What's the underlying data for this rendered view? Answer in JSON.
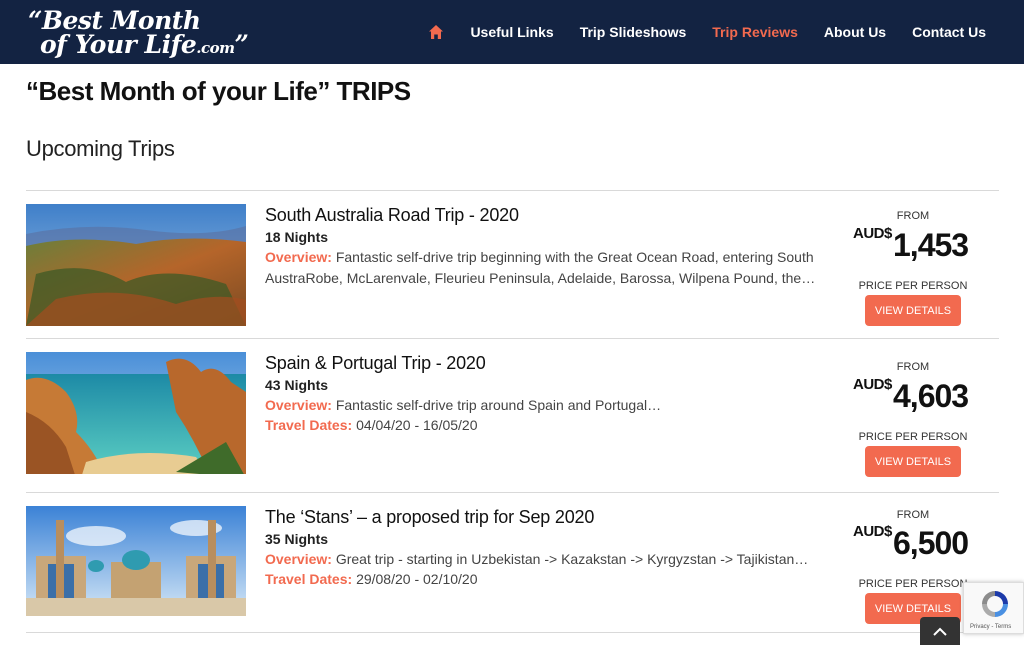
{
  "header": {
    "logo_line1": "“Best Month",
    "logo_line2": "of Your Life",
    "logo_domain": ".com",
    "logo_close": "”",
    "nav": [
      {
        "label": "Useful Links",
        "active": false
      },
      {
        "label": "Trip Slideshows",
        "active": false
      },
      {
        "label": "Trip Reviews",
        "active": true
      },
      {
        "label": "About Us",
        "active": false
      },
      {
        "label": "Contact Us",
        "active": false
      }
    ],
    "home_icon": "home-icon"
  },
  "page_title": "“Best Month of your Life” TRIPS",
  "section_title": "Upcoming Trips",
  "trips": [
    {
      "name": "South Australia Road Trip - 2020",
      "nights": "18 Nights",
      "overview_label": "Overview:",
      "overview": "Fantastic self-drive trip beginning with the Great Ocean Road, entering South AustraRobe, McLarenvale, Fleurieu Peninsula, Adelaide, Barossa, Wilpena Pound, the…",
      "price_from": "FROM",
      "currency": "AUD$",
      "price": "1,453",
      "price_note": "PRICE PER PERSON",
      "button": "VIEW DETAILS"
    },
    {
      "name": "Spain & Portugal Trip - 2020",
      "nights": "43 Nights",
      "overview_label": "Overview:",
      "overview": "Fantastic self-drive trip around Spain and Portugal…",
      "dates_label": "Travel Dates:",
      "dates": "04/04/20 - 16/05/20",
      "price_from": "FROM",
      "currency": "AUD$",
      "price": "4,603",
      "price_note": "PRICE PER PERSON",
      "button": "VIEW DETAILS"
    },
    {
      "name": "The ‘Stans’ – a proposed trip for Sep 2020",
      "nights": "35 Nights",
      "overview_label": "Overview:",
      "overview": "Great trip - starting in Uzbekistan -> Kazakstan -> Kyrgyzstan -> Tajikistan…",
      "dates_label": "Travel Dates:",
      "dates": "29/08/20 - 02/10/20",
      "price_from": "FROM",
      "currency": "AUD$",
      "price": "6,500",
      "price_note": "PRICE PER PERSON",
      "button": "VIEW DETAILS"
    }
  ],
  "recaptcha": {
    "privacy": "Privacy",
    "terms": "Terms"
  },
  "colors": {
    "navbar": "#132342",
    "accent": "#f26a4f"
  }
}
